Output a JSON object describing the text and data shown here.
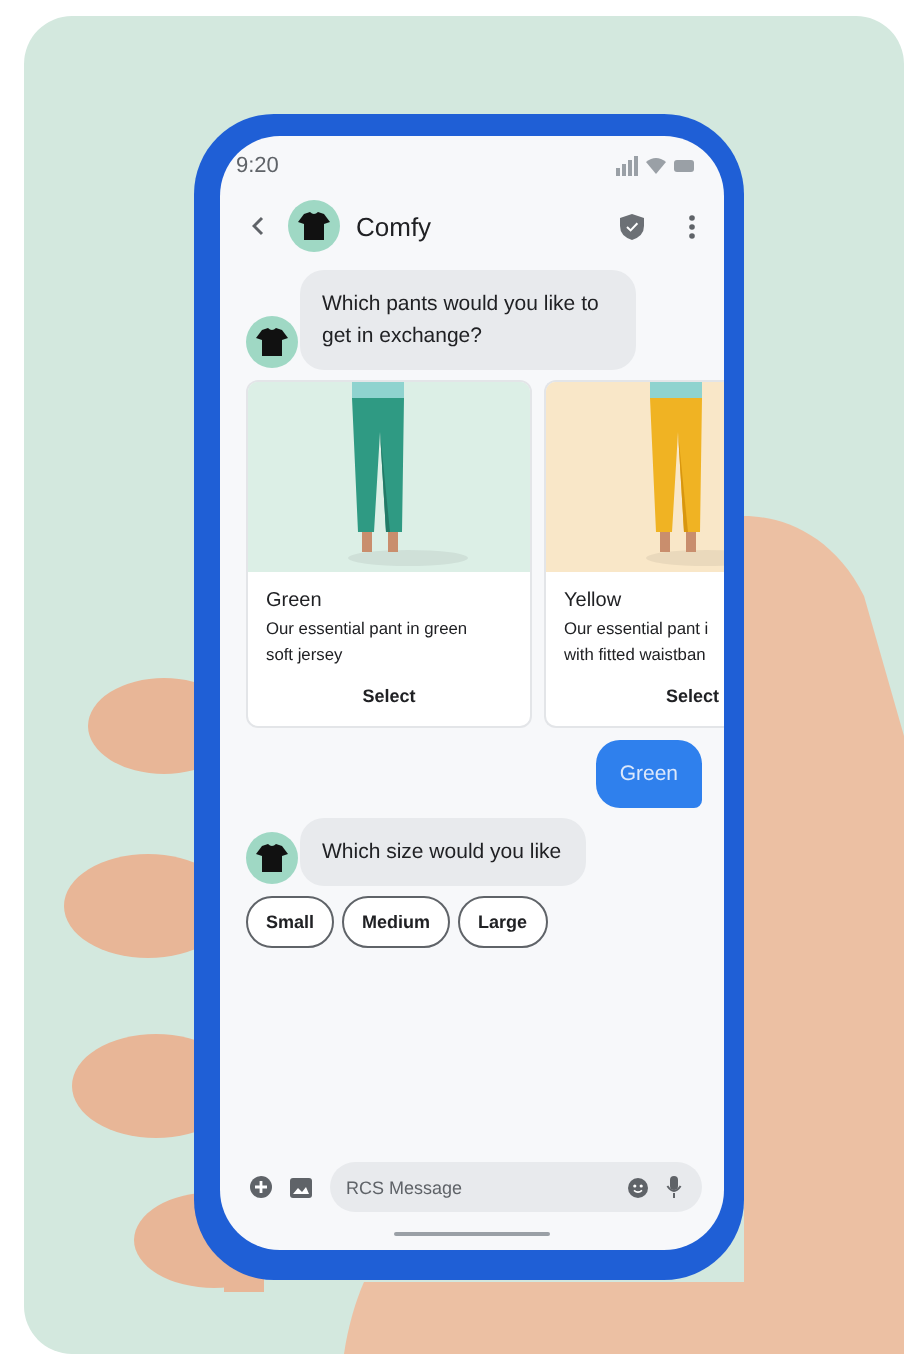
{
  "status_bar": {
    "time": "9:20"
  },
  "header": {
    "title": "Comfy"
  },
  "messages": [
    {
      "kind": "incoming",
      "text": "Which pants would you like to get in exchange?"
    },
    {
      "kind": "carousel",
      "cards": [
        {
          "title": "Green",
          "description_lines": [
            "Our essential pant in green",
            "soft jersey"
          ],
          "action": "Select"
        },
        {
          "title": "Yellow",
          "description_lines": [
            "Our essential pant i",
            "with fitted waistban"
          ],
          "action": "Select"
        }
      ]
    },
    {
      "kind": "outgoing",
      "text": "Green"
    },
    {
      "kind": "incoming",
      "text": "Which size would you like"
    },
    {
      "kind": "chips",
      "chips": [
        "Small",
        "Medium",
        "Large"
      ]
    }
  ],
  "composer": {
    "placeholder": "RCS Message"
  }
}
